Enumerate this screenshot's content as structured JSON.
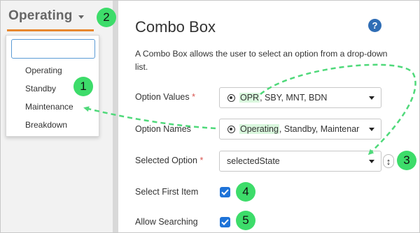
{
  "preview": {
    "combo_value": "Operating",
    "dropdown": {
      "search_value": "",
      "items": [
        "Operating",
        "Standby",
        "Maintenance",
        "Breakdown"
      ]
    }
  },
  "callouts": [
    "1",
    "2",
    "3",
    "4",
    "5"
  ],
  "panel": {
    "title": "Combo Box",
    "help_icon": "?",
    "description": "A Combo Box allows the user to select an option from a drop-down list.",
    "required_mark": "*",
    "option_values": {
      "label": "Option Values",
      "value_highlight": "OPR",
      "value_rest": ", SBY, MNT, BDN"
    },
    "option_names": {
      "label": "Option Names",
      "value_highlight": "Operating",
      "value_rest": ", Standby, Maintenar"
    },
    "selected_option": {
      "label": "Selected Option",
      "value": "selectedState",
      "switch_icon": "↕"
    },
    "select_first_item": {
      "label": "Select First Item",
      "checked": true
    },
    "allow_searching": {
      "label": "Allow Searching",
      "checked": true
    }
  },
  "colors": {
    "accent_orange": "#e8872e",
    "callout_green": "#3ddc6a",
    "arrow_green": "#4fd97a",
    "checkbox_blue": "#1e73d8",
    "help_blue": "#2f6db5",
    "required_red": "#d9534f"
  }
}
